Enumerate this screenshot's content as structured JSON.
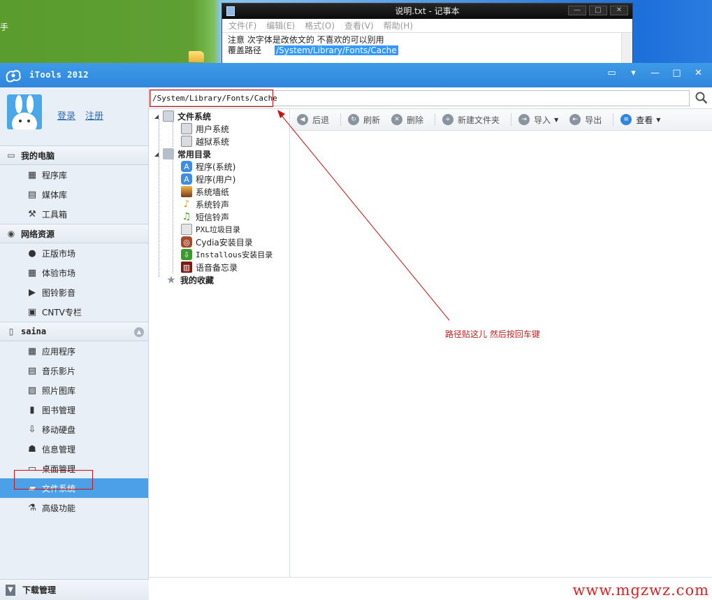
{
  "desktop": {
    "left_fragment": "手"
  },
  "notepad": {
    "title": "说明.txt - 记事本",
    "menu": [
      "文件(F)",
      "编辑(E)",
      "格式(O)",
      "查看(V)",
      "帮助(H)"
    ],
    "line1": "注意  次字体是改依文的  不喜欢的可以别用",
    "line2_label": "覆盖路径",
    "line2_path": "/System/Library/Fonts/Cache"
  },
  "app": {
    "title": "iTools 2012"
  },
  "profile": {
    "login": "登录",
    "register": "注册"
  },
  "sidebar": {
    "my_computer": {
      "header": "我的电脑",
      "items": [
        {
          "label": "程序库",
          "icon": "grid-icon"
        },
        {
          "label": "媒体库",
          "icon": "film-icon"
        },
        {
          "label": "工具箱",
          "icon": "wrench-icon"
        }
      ]
    },
    "network": {
      "header": "网络资源",
      "items": [
        {
          "label": "正版市场",
          "icon": "apple-icon"
        },
        {
          "label": "体验市场",
          "icon": "grid-icon"
        },
        {
          "label": "图铃影音",
          "icon": "play-icon"
        },
        {
          "label": "CNTV专栏",
          "icon": "tv-icon"
        }
      ]
    },
    "device": {
      "header": "saina",
      "items": [
        {
          "label": "应用程序",
          "icon": "grid-icon"
        },
        {
          "label": "音乐影片",
          "icon": "film-icon"
        },
        {
          "label": "照片图库",
          "icon": "photo-icon"
        },
        {
          "label": "图书管理",
          "icon": "book-icon"
        },
        {
          "label": "移动硬盘",
          "icon": "usb-icon"
        },
        {
          "label": "信息管理",
          "icon": "contact-icon"
        },
        {
          "label": "桌面管理",
          "icon": "desktop-icon"
        },
        {
          "label": "文件系统",
          "icon": "folder-icon",
          "active": true
        },
        {
          "label": "高级功能",
          "icon": "flask-icon"
        }
      ]
    },
    "download": "下载管理"
  },
  "pathbar": {
    "value": "/System/Library/Fonts/Cache"
  },
  "tree": {
    "filesystem": "文件系统",
    "user_system": "用户系统",
    "jailbreak_system": "越狱系统",
    "common_dirs": "常用目录",
    "common_items": [
      "程序(系统)",
      "程序(用户)",
      "系统墙纸",
      "系统铃声",
      "短信铃声",
      "PXL垃圾目录",
      "Cydia安装目录",
      "Installous安装目录",
      "语音备忘录"
    ],
    "favorites": "我的收藏"
  },
  "toolbar": {
    "back": "后退",
    "refresh": "刷新",
    "delete": "删除",
    "new_folder": "新建文件夹",
    "import": "导入",
    "export": "导出",
    "view": "查看"
  },
  "annotation": "路径贴这儿   然后按回车键",
  "watermark": "www.mgzwz.com",
  "colors": {
    "accent": "#2f86db",
    "active_nav": "#4ca0e8",
    "annotation_red": "#c8201c"
  }
}
